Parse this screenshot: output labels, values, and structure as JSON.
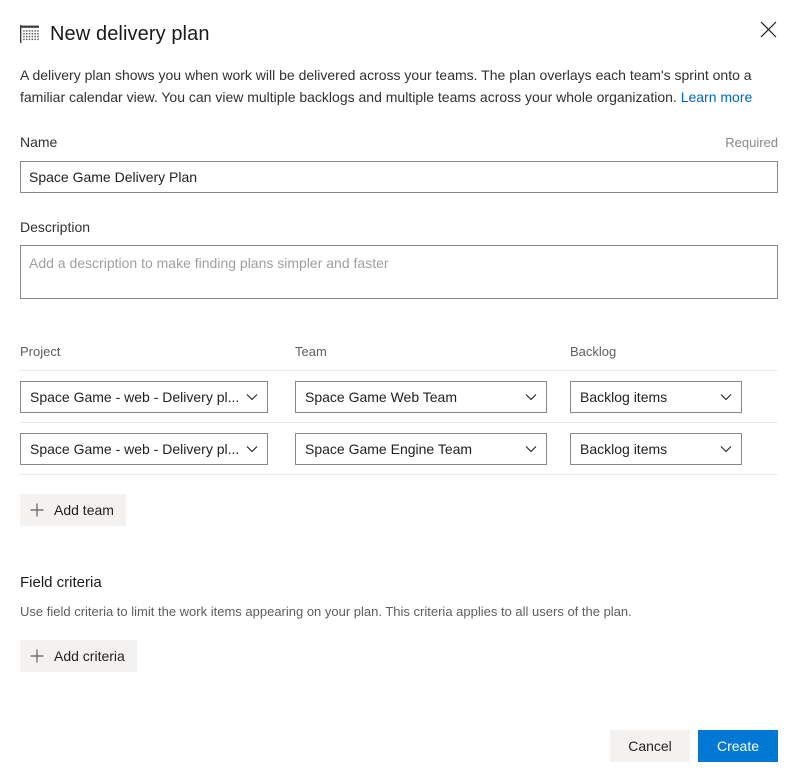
{
  "header": {
    "icon": "delivery-plan-icon",
    "title": "New delivery plan",
    "close_icon": "close-icon"
  },
  "intro": {
    "text": "A delivery plan shows you when work will be delivered across your teams. The plan overlays each team's sprint onto a familiar calendar view. You can view multiple backlogs and multiple teams across your whole organization.",
    "link_label": "Learn more"
  },
  "name_field": {
    "label": "Name",
    "required_note": "Required",
    "value": "Space Game Delivery Plan",
    "placeholder": ""
  },
  "description_field": {
    "label": "Description",
    "value": "",
    "placeholder": "Add a description to make finding plans simpler and faster"
  },
  "teams_table": {
    "columns": [
      "Project",
      "Team",
      "Backlog"
    ],
    "rows": [
      {
        "project": "Space Game - web - Delivery pl...",
        "team": "Space Game Web Team",
        "backlog": "Backlog items"
      },
      {
        "project": "Space Game - web - Delivery pl...",
        "team": "Space Game Engine Team",
        "backlog": "Backlog items"
      }
    ],
    "add_team_label": "Add team",
    "add_icon": "plus-icon",
    "chevron_icon": "chevron-down-icon"
  },
  "field_criteria": {
    "title": "Field criteria",
    "description": "Use field criteria to limit the work items appearing on your plan. This criteria applies to all users of the plan.",
    "add_criteria_label": "Add criteria",
    "add_icon": "plus-icon"
  },
  "footer": {
    "cancel_label": "Cancel",
    "create_label": "Create"
  },
  "colors": {
    "primary": "#0078d4",
    "link": "#0066cc",
    "button_secondary_bg": "#f3f2f1",
    "border": "#8a8886",
    "divider": "#edebe9"
  }
}
